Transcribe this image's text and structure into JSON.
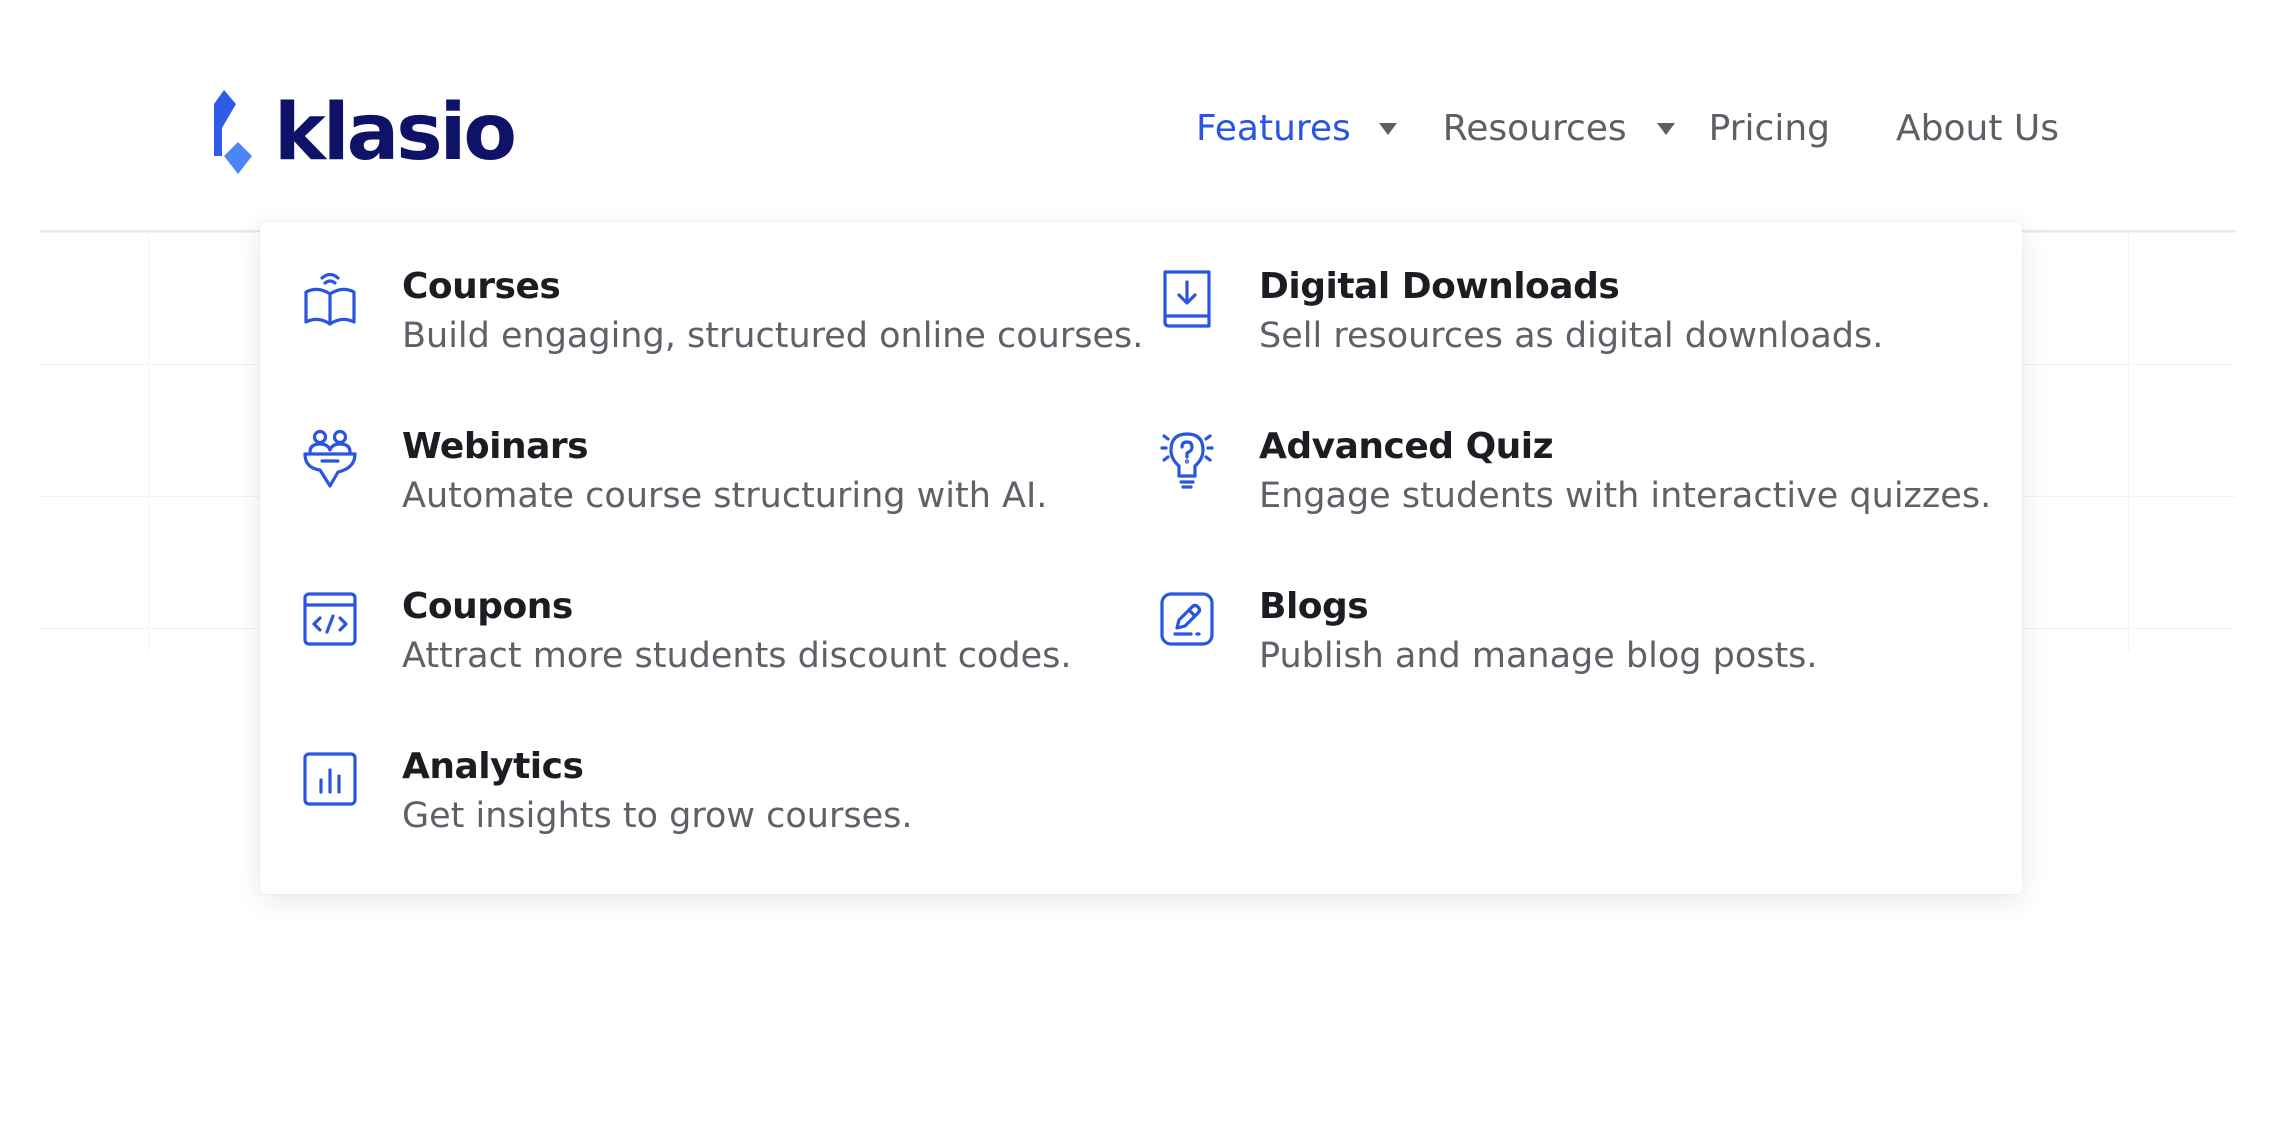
{
  "brand": {
    "name": "klasio",
    "logo_color": "#0e1368",
    "accent": "#2a55e0"
  },
  "nav": {
    "items": [
      {
        "label": "Features",
        "has_caret": true,
        "active": true
      },
      {
        "label": "Resources",
        "has_caret": true,
        "active": false
      },
      {
        "label": "Pricing",
        "has_caret": false,
        "active": false
      },
      {
        "label": "About Us",
        "has_caret": false,
        "active": false
      }
    ]
  },
  "features_menu": {
    "items": [
      {
        "title": "Courses",
        "description": "Build engaging, structured online courses.",
        "icon": "book-icon"
      },
      {
        "title": "Digital Downloads",
        "description": "Sell resources as digital downloads.",
        "icon": "download-book-icon"
      },
      {
        "title": "Webinars",
        "description": "Automate course structuring with AI.",
        "icon": "webinar-icon"
      },
      {
        "title": "Advanced Quiz",
        "description": "Engage students with interactive quizzes.",
        "icon": "lightbulb-question-icon"
      },
      {
        "title": "Coupons",
        "description": "Attract more students discount codes.",
        "icon": "code-window-icon"
      },
      {
        "title": "Blogs",
        "description": "Publish and manage blog posts.",
        "icon": "edit-pencil-icon"
      },
      {
        "title": "Analytics",
        "description": "Get insights to grow courses.",
        "icon": "bar-chart-icon"
      }
    ]
  }
}
